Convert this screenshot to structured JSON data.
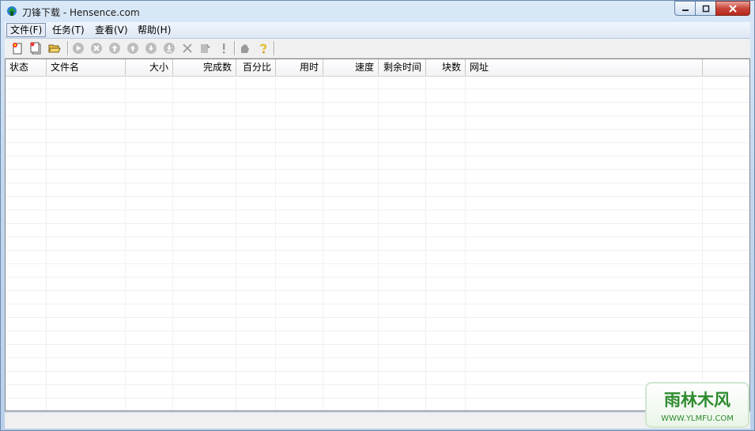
{
  "window": {
    "title": "刀锋下载 - Hensence.com"
  },
  "caption_buttons": {
    "minimize": "▭",
    "maximize": "▢",
    "close": "✕"
  },
  "menu": [
    {
      "label": "文件(F)"
    },
    {
      "label": "任务(T)"
    },
    {
      "label": "查看(V)"
    },
    {
      "label": "帮助(H)"
    }
  ],
  "toolbar": [
    {
      "name": "new-task-icon"
    },
    {
      "name": "batch-new-icon"
    },
    {
      "name": "open-folder-icon"
    },
    {
      "name": "start-icon"
    },
    {
      "name": "stop-icon"
    },
    {
      "name": "move-top-icon"
    },
    {
      "name": "move-up-icon"
    },
    {
      "name": "move-down-icon"
    },
    {
      "name": "move-bottom-icon"
    },
    {
      "name": "delete-icon"
    },
    {
      "name": "properties-icon"
    },
    {
      "name": "alert-icon"
    },
    {
      "name": "options-icon"
    },
    {
      "name": "help-icon"
    }
  ],
  "columns": [
    {
      "label": "状态"
    },
    {
      "label": "文件名"
    },
    {
      "label": "大小"
    },
    {
      "label": "完成数"
    },
    {
      "label": "百分比"
    },
    {
      "label": "用时"
    },
    {
      "label": "速度"
    },
    {
      "label": "剩余时间"
    },
    {
      "label": "块数"
    },
    {
      "label": "网址"
    }
  ],
  "watermark": {
    "text_top": "雨林木风",
    "text_bottom": "WWW.YLMFU.COM"
  },
  "colors": {
    "accent": "#3a6ea5",
    "close": "#c8463a",
    "brand_green": "#2e8b2e"
  }
}
